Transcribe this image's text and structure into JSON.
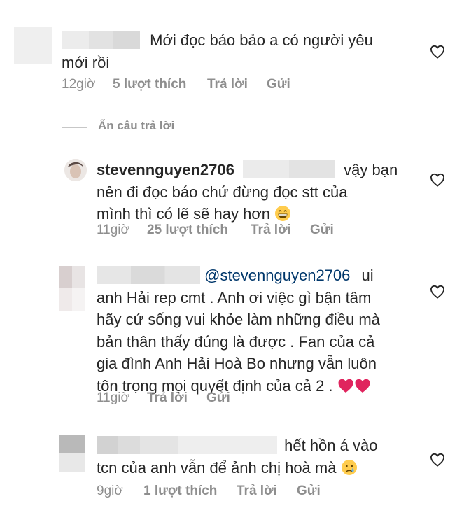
{
  "comments": [
    {
      "username": "",
      "text": "Mới đọc báo bảo a có người yêu mới rồi",
      "line1": "Mới đọc báo bảo a có người yêu",
      "line2": "mới rồi",
      "time": "12giờ",
      "likes": "5 lượt thích",
      "reply": "Trả lời",
      "send": "Gửi",
      "heart_icon": "heart-outline-icon"
    },
    {
      "username": "stevennguyen2706",
      "text": "vậy bạn nên đi đọc báo chứ đừng đọc stt của mình thì có lẽ sẽ hay hơn 😁",
      "line1": "vậy bạn",
      "line2": "nên đi đọc báo chứ đừng đọc stt của",
      "line3": "mình thì có lẽ sẽ hay hơn",
      "emoji": "grinning-face-emoji",
      "time": "11giờ",
      "likes": "25 lượt thích",
      "reply": "Trả lời",
      "send": "Gửi",
      "heart_icon": "heart-outline-icon"
    },
    {
      "username": "",
      "mention": "@stevennguyen2706",
      "text": "ui anh Hải rep cmt . Anh ơi việc gì bận tâm hãy cứ sống vui khỏe làm những điều mà bản thân thấy đúng là được . Fan của cả gia đình Anh Hải Hoà Bo nhưng vẫn luôn tôn trọng mọi quyết định của cả 2 . ❤️❤️",
      "line1": "ui",
      "line2": "anh Hải rep cmt . Anh ơi việc gì bận tâm",
      "line3": "hãy cứ sống vui khỏe làm những điều mà",
      "line4": "bản thân thấy đúng là được . Fan của cả",
      "line5": "gia đình Anh Hải Hoà Bo nhưng vẫn luôn",
      "line6": "tôn trọng mọi quyết định của cả 2 .",
      "emoji": "red-heart-emoji",
      "time": "11giờ",
      "reply": "Trả lời",
      "send": "Gửi",
      "heart_icon": "heart-outline-icon"
    },
    {
      "username": "",
      "text": "hết hồn á vào tcn của anh vẫn để ảnh chị hoà mà 😢",
      "line1": "hết hồn á vào",
      "line2": "tcn của anh vẫn để ảnh chị hoà mà",
      "emoji": "crying-face-emoji",
      "time": "9giờ",
      "likes": "1 lượt thích",
      "reply": "Trả lời",
      "send": "Gửi",
      "heart_icon": "heart-outline-icon"
    }
  ],
  "hide_replies": "Ẩn câu trả lời",
  "colors": {
    "text": "#262626",
    "meta": "#8e8e8e",
    "mention": "#00376b",
    "heart_emoji": "#e0245e"
  }
}
